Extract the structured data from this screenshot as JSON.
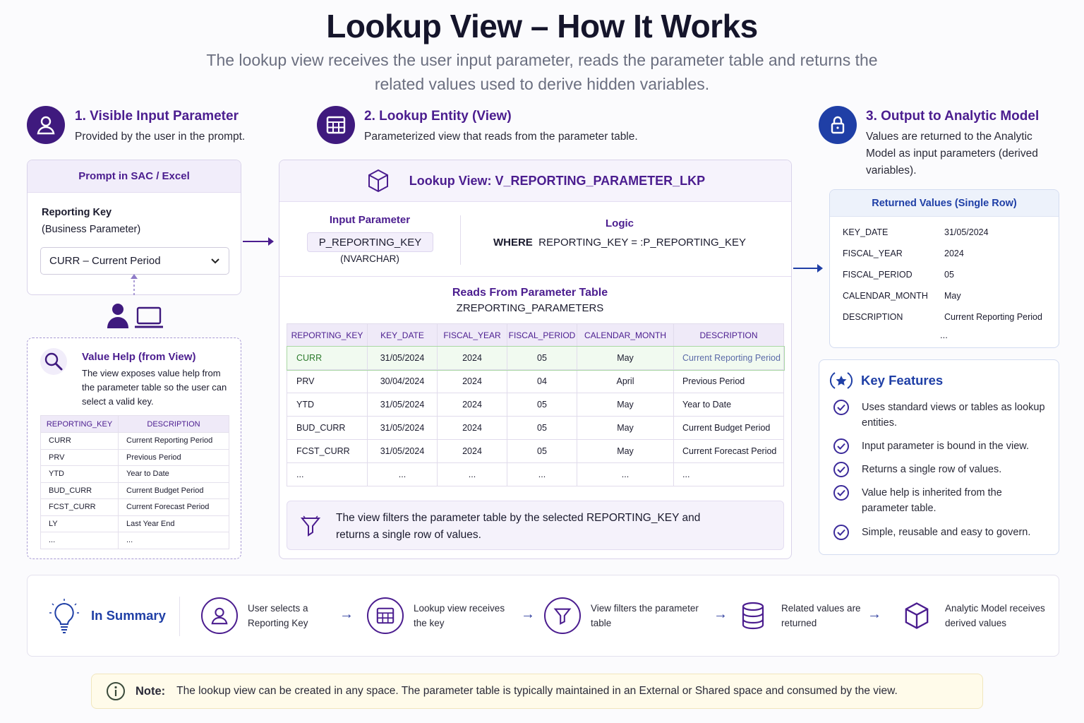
{
  "title": "Lookup View – How It Works",
  "subtitle": "The lookup view receives the user input parameter, reads the parameter table and returns the related values used to derive hidden variables.",
  "steps": {
    "s1": {
      "title": "1. Visible Input Parameter",
      "text": "Provided by the user in the prompt.",
      "icon": "user-icon"
    },
    "s2": {
      "title": "2. Lookup Entity (View)",
      "text": "Parameterized view that reads from the parameter table.",
      "icon": "table-icon"
    },
    "s3": {
      "title": "3. Output to Analytic Model",
      "text": "Values are returned to the Analytic Model as input parameters (derived variables).",
      "icon": "lock-icon"
    }
  },
  "prompt": {
    "head": "Prompt in SAC / Excel",
    "label": "Reporting Key",
    "sublabel": "(Business Parameter)",
    "value": "CURR – Current Period"
  },
  "value_help": {
    "title": "Value Help (from View)",
    "text": "The view exposes value help from the parameter table so the user can select a valid key.",
    "columns": [
      "REPORTING_KEY",
      "DESCRIPTION"
    ],
    "rows": [
      [
        "CURR",
        "Current Reporting Period"
      ],
      [
        "PRV",
        "Previous Period"
      ],
      [
        "YTD",
        "Year to Date"
      ],
      [
        "BUD_CURR",
        "Current Budget Period"
      ],
      [
        "FCST_CURR",
        "Current Forecast Period"
      ],
      [
        "LY",
        "Last Year End"
      ],
      [
        "...",
        "..."
      ]
    ]
  },
  "lookup": {
    "head": "Lookup View: V_REPORTING_PARAMETER_LKP",
    "input_label": "Input Parameter",
    "input_name": "P_REPORTING_KEY",
    "input_type": "(NVARCHAR)",
    "logic_label": "Logic",
    "logic_kw": "WHERE",
    "logic_expr": "REPORTING_KEY = :P_REPORTING_KEY",
    "reads_label": "Reads From Parameter Table",
    "table_name": "ZREPORTING_PARAMETERS",
    "columns": [
      "REPORTING_KEY",
      "KEY_DATE",
      "FISCAL_YEAR",
      "FISCAL_PERIOD",
      "CALENDAR_MONTH",
      "DESCRIPTION"
    ],
    "rows": [
      [
        "CURR",
        "31/05/2024",
        "2024",
        "05",
        "May",
        "Current Reporting Period"
      ],
      [
        "PRV",
        "30/04/2024",
        "2024",
        "04",
        "April",
        "Previous Period"
      ],
      [
        "YTD",
        "31/05/2024",
        "2024",
        "05",
        "May",
        "Year to Date"
      ],
      [
        "BUD_CURR",
        "31/05/2024",
        "2024",
        "05",
        "May",
        "Current Budget Period"
      ],
      [
        "FCST_CURR",
        "31/05/2024",
        "2024",
        "05",
        "May",
        "Current Forecast Period"
      ],
      [
        "...",
        "...",
        "...",
        "...",
        "...",
        "..."
      ]
    ],
    "filter_note": "The view filters the parameter table by the selected REPORTING_KEY and returns a single row of values."
  },
  "returned": {
    "head": "Returned Values (Single Row)",
    "rows": [
      [
        "KEY_DATE",
        "31/05/2024"
      ],
      [
        "FISCAL_YEAR",
        "2024"
      ],
      [
        "FISCAL_PERIOD",
        "05"
      ],
      [
        "CALENDAR_MONTH",
        "May"
      ],
      [
        "DESCRIPTION",
        "Current Reporting Period"
      ]
    ],
    "more": "..."
  },
  "features": {
    "title": "Key Features",
    "items": [
      "Uses standard views or tables as lookup entities.",
      "Input parameter is bound in the view.",
      "Returns a single row of values.",
      "Value help is inherited from the parameter table.",
      "Simple, reusable and easy to govern."
    ]
  },
  "summary": {
    "title": "In Summary",
    "steps": [
      {
        "text": "User selects a Reporting Key",
        "icon": "user-icon"
      },
      {
        "text": "Lookup view receives the key",
        "icon": "table-icon"
      },
      {
        "text": "View filters the parameter table",
        "icon": "filter-icon"
      },
      {
        "text": "Related values are returned",
        "icon": "database-icon"
      },
      {
        "text": "Analytic Model receives derived values",
        "icon": "cube-icon"
      }
    ]
  },
  "note": {
    "label": "Note:",
    "text": "The lookup view can be created in any space. The parameter table is typically maintained in an External or Shared space and consumed by the view."
  },
  "colors": {
    "brand": "#4b1d8f",
    "accent_blue": "#1f3fa6",
    "highlight_green": "#f1faf0"
  }
}
